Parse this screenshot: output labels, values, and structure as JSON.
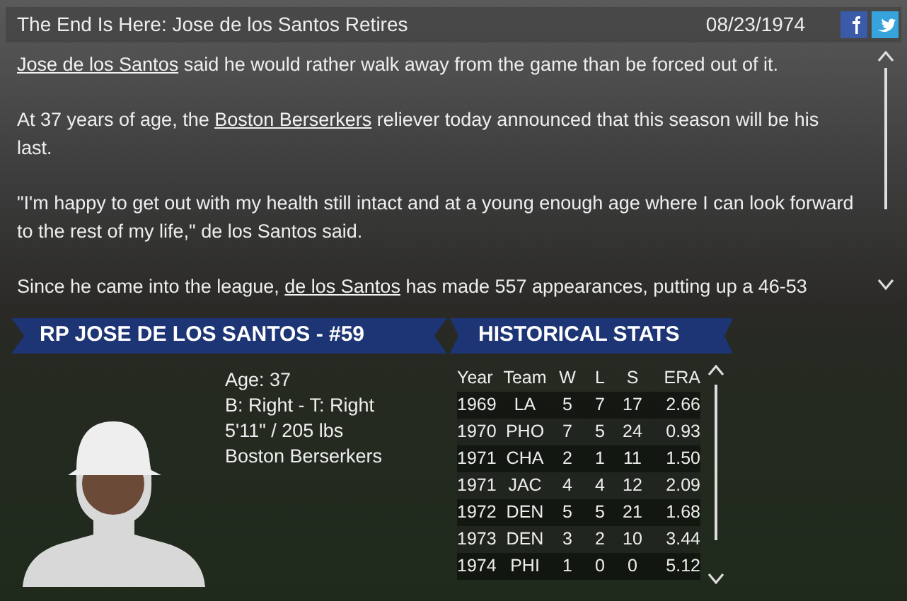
{
  "header": {
    "title": "The End Is Here: Jose de los Santos Retires",
    "date": "08/23/1974"
  },
  "article": [
    [
      {
        "text": "Jose de los Santos",
        "link": true
      },
      {
        "text": " said he would rather walk away from the game than be forced out of it.",
        "link": false
      }
    ],
    [
      {
        "text": "At 37 years of age, the ",
        "link": false
      },
      {
        "text": "Boston Berserkers",
        "link": true
      },
      {
        "text": " reliever today announced that this season will be his last.",
        "link": false
      }
    ],
    [
      {
        "text": "\"I'm happy to get out with my health still intact and at a young enough age where I can look forward to the rest of my life,\" de los Santos said.",
        "link": false
      }
    ],
    [
      {
        "text": "Since he came into the league, ",
        "link": false
      },
      {
        "text": "de los Santos",
        "link": true
      },
      {
        "text": " has made 557 appearances, putting up a 46-53",
        "link": false
      }
    ]
  ],
  "player": {
    "banner": "RP JOSE DE LOS SANTOS - #59",
    "info": [
      "Age: 37",
      "B: Right - T: Right",
      "5'11\" / 205 lbs",
      "Boston Berserkers"
    ]
  },
  "stats": {
    "banner": "HISTORICAL STATS",
    "columns": [
      "Year",
      "Team",
      "W",
      "L",
      "S",
      "ERA"
    ],
    "rows": [
      [
        "1969",
        "LA",
        "5",
        "7",
        "17",
        "2.66"
      ],
      [
        "1970",
        "PHO",
        "7",
        "5",
        "24",
        "0.93"
      ],
      [
        "1971",
        "CHA",
        "2",
        "1",
        "11",
        "1.50"
      ],
      [
        "1971",
        "JAC",
        "4",
        "4",
        "12",
        "2.09"
      ],
      [
        "1972",
        "DEN",
        "5",
        "5",
        "21",
        "1.68"
      ],
      [
        "1973",
        "DEN",
        "3",
        "2",
        "10",
        "3.44"
      ],
      [
        "1974",
        "PHI",
        "1",
        "0",
        "0",
        "5.12"
      ]
    ]
  }
}
